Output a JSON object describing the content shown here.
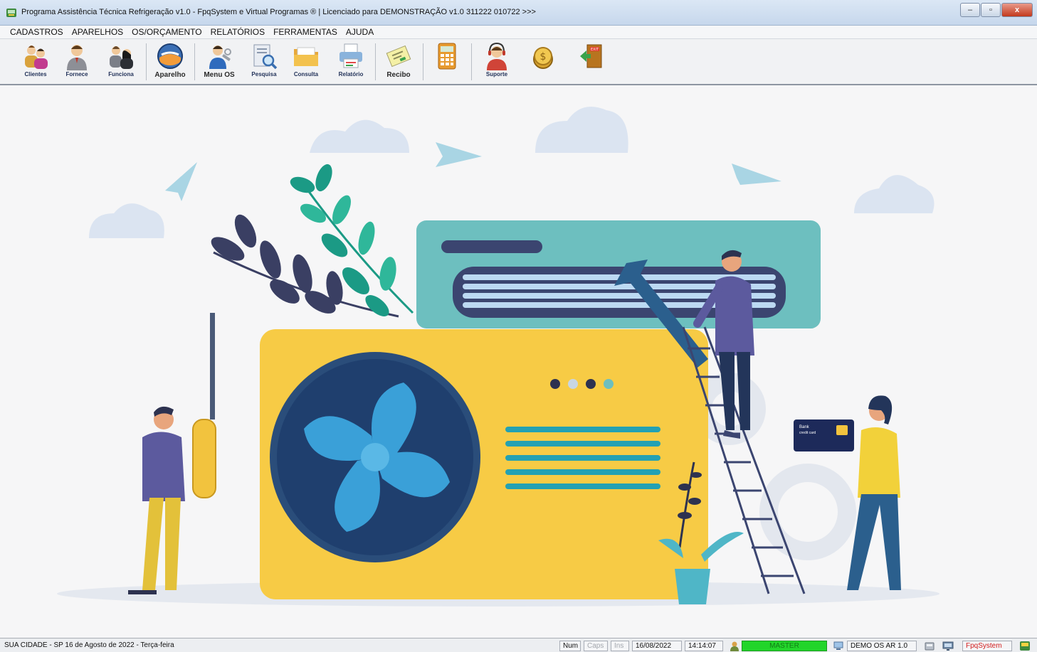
{
  "window": {
    "title": "Programa Assistência Técnica Refrigeração v1.0 - FpqSystem e Virtual Programas ® | Licenciado para  DEMONSTRAÇÃO v1.0 311222 010722 >>>",
    "minimize": "–",
    "maximize": "▫",
    "close": "x"
  },
  "menu": [
    "CADASTROS",
    "APARELHOS",
    "OS/ORÇAMENTO",
    "RELATÓRIOS",
    "FERRAMENTAS",
    "AJUDA"
  ],
  "toolbar": {
    "clientes": "Clientes",
    "fornece": "Fornece",
    "funciona": "Funciona",
    "aparelho": "Aparelho",
    "menu_os": "Menu OS",
    "pesquisa": "Pesquisa",
    "consulta": "Consulta",
    "relatorio": "Relatório",
    "recibo": "Recibo",
    "suporte": "Suporte"
  },
  "illustration": {
    "card_text_1": "Bank",
    "card_text_2": "credit card"
  },
  "status": {
    "left": "SUA CIDADE - SP 16 de Agosto de 2022 - Terça-feira",
    "num": "Num",
    "caps": "Caps",
    "ins": "Ins",
    "date": "16/08/2022",
    "time": "14:14:07",
    "user": "MASTER",
    "version": "DEMO OS AR 1.0",
    "brand": "FpqSystem"
  },
  "colors": {
    "unit_yellow": "#f7cb45",
    "indoor_teal": "#6dbfbf",
    "fan_navy": "#1f3f6e",
    "fan_blade": "#3aa0d8",
    "status_green": "#22d52a"
  }
}
